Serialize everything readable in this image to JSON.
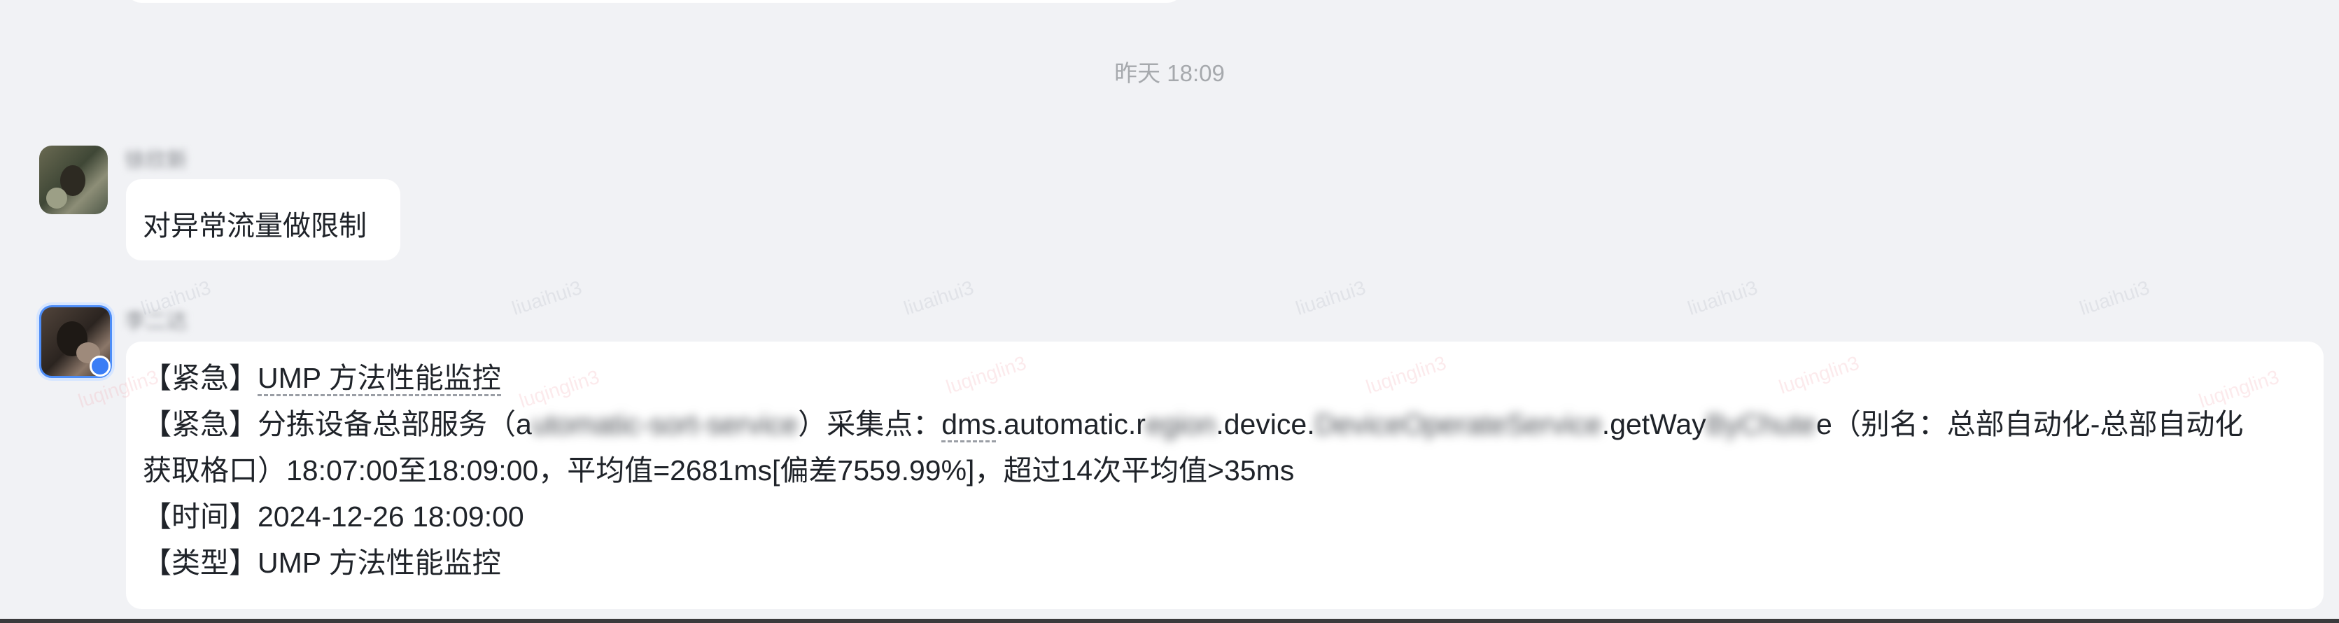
{
  "time_divider": "昨天 18:09",
  "messages": [
    {
      "sender": "徐欣新",
      "text": "对异常流量做限制"
    },
    {
      "sender": "李二达",
      "line1_prefix": "【紧急】",
      "line1_title": "UMP 方法性能监控",
      "line2_a": "【紧急】分拣设备总部服务（a",
      "line2_masked1": "utomatic-sort-service",
      "line2_b": "）采集点：",
      "line2_link_dms": "dms",
      "line2_c": ".automatic.r",
      "line2_masked2": "egion",
      "line2_d": ".device.",
      "line2_masked3": "DeviceOperateService",
      "line2_e": ".getWay",
      "line2_masked4": "ByChute",
      "line2_f": "e（别名：总部自动化-总部自动化",
      "line3": "获取格口）18:07:00至18:09:00，平均值=2681ms[偏差7559.99%]，超过14次平均值>35ms",
      "line4": "【时间】2024-12-26 18:09:00",
      "line5": "【类型】UMP 方法性能监控"
    }
  ],
  "watermarks": [
    "liuaihui3",
    "luqinglin3"
  ],
  "colors": {
    "background": "#f1f2f5",
    "bubble": "#ffffff",
    "avatar_ring": "#4d8df7",
    "muted_text": "#a6a9ad"
  }
}
